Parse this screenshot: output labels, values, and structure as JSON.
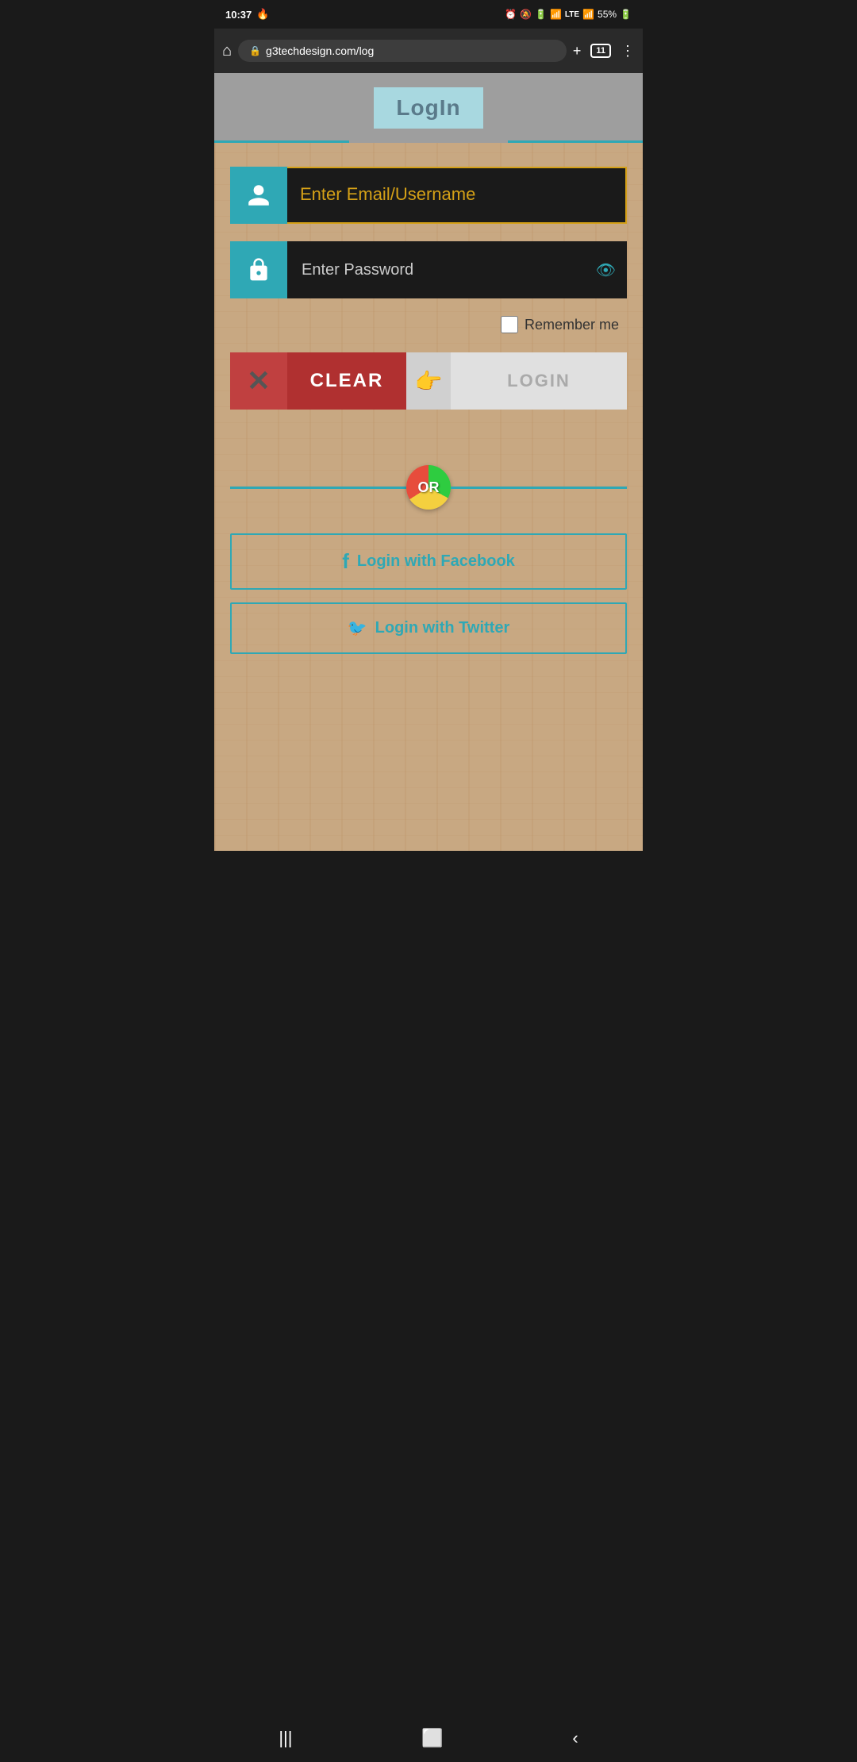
{
  "statusBar": {
    "time": "10:37",
    "batteryPercent": "55%",
    "signalIcon": "📶"
  },
  "browserBar": {
    "url": "g3techdesign.com/log",
    "tabCount": "11"
  },
  "header": {
    "title": "LogIn"
  },
  "form": {
    "emailPlaceholder": "Enter Email/Username",
    "passwordPlaceholder": "Enter Password",
    "rememberLabel": "Remember me",
    "clearLabel": "CLEAR",
    "loginLabel": "LOGIN"
  },
  "orDivider": {
    "text": "OR"
  },
  "social": {
    "facebookLabel": "Login with Facebook",
    "twitterLabel": "Login with Twitter"
  },
  "colors": {
    "teal": "#2fa8b5",
    "red": "#b03030",
    "gold": "#d4a017"
  }
}
